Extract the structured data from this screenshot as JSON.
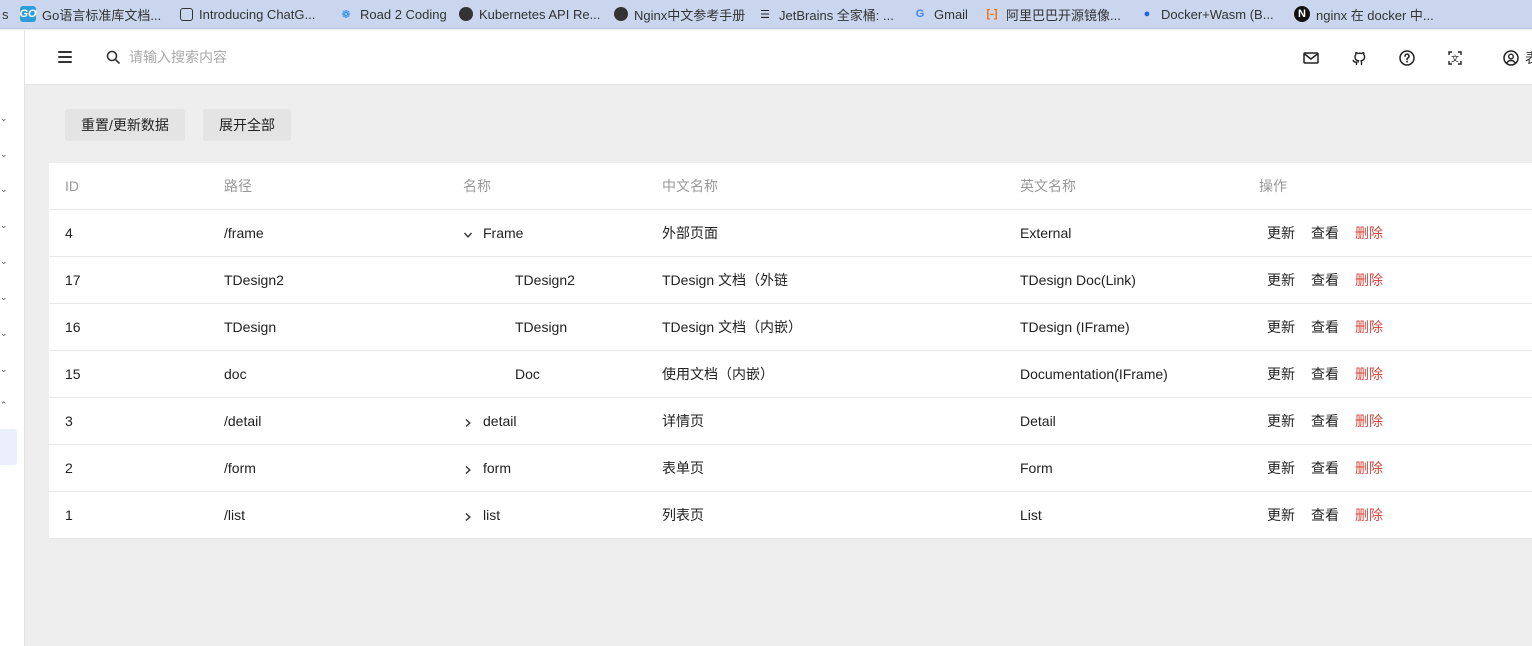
{
  "bookmarks": {
    "edge": "s",
    "items": [
      {
        "label": "Go语言标准库文档...",
        "icon": "go-logo-icon"
      },
      {
        "label": "Introducing ChatG...",
        "icon": "openai-icon"
      },
      {
        "label": "Road 2 Coding",
        "icon": "footprint-icon"
      },
      {
        "label": "Kubernetes API Re...",
        "icon": "globe-icon"
      },
      {
        "label": "Nginx中文参考手册",
        "icon": "globe-icon"
      },
      {
        "label": "JetBrains 全家桶: ...",
        "icon": "layers-icon"
      },
      {
        "label": "Gmail",
        "icon": "google-icon"
      },
      {
        "label": "阿里巴巴开源镜像...",
        "icon": "aliyun-icon"
      },
      {
        "label": "Docker+Wasm (B...",
        "icon": "docker-icon"
      },
      {
        "label": "nginx 在 docker 中...",
        "icon": "nginx-icon"
      }
    ]
  },
  "topbar": {
    "search_placeholder": "请输入搜索内容",
    "user_text": "表",
    "icons": [
      "mail-icon",
      "github-icon",
      "help-icon",
      "translate-icon",
      "user-icon"
    ]
  },
  "toolbar": {
    "reset_label": "重置/更新数据",
    "expand_label": "展开全部"
  },
  "table": {
    "headers": {
      "id": "ID",
      "path": "路径",
      "name": "名称",
      "cn": "中文名称",
      "en": "英文名称",
      "op": "操作"
    },
    "actions": {
      "update": "更新",
      "view": "查看",
      "delete": "删除"
    },
    "rows": [
      {
        "id": "4",
        "path": "/frame",
        "name": "Frame",
        "cn": "外部页面",
        "en": "External",
        "expander": "expanded",
        "level": 0
      },
      {
        "id": "17",
        "path": "TDesign2",
        "name": "TDesign2",
        "cn": "TDesign 文档（外链",
        "en": "TDesign Doc(Link)",
        "expander": "none",
        "level": 1
      },
      {
        "id": "16",
        "path": "TDesign",
        "name": "TDesign",
        "cn": "TDesign 文档（内嵌）",
        "en": "TDesign (IFrame)",
        "expander": "none",
        "level": 1
      },
      {
        "id": "15",
        "path": "doc",
        "name": "Doc",
        "cn": "使用文档（内嵌）",
        "en": "Documentation(IFrame)",
        "expander": "none",
        "level": 1
      },
      {
        "id": "3",
        "path": "/detail",
        "name": "detail",
        "cn": "详情页",
        "en": "Detail",
        "expander": "collapsed",
        "level": 0
      },
      {
        "id": "2",
        "path": "/form",
        "name": "form",
        "cn": "表单页",
        "en": "Form",
        "expander": "collapsed",
        "level": 0
      },
      {
        "id": "1",
        "path": "/list",
        "name": "list",
        "cn": "列表页",
        "en": "List",
        "expander": "collapsed",
        "level": 0
      }
    ]
  },
  "colors": {
    "danger": "#d54941",
    "header_text": "#999999",
    "bookmark_bar": "#c9d6ee"
  }
}
